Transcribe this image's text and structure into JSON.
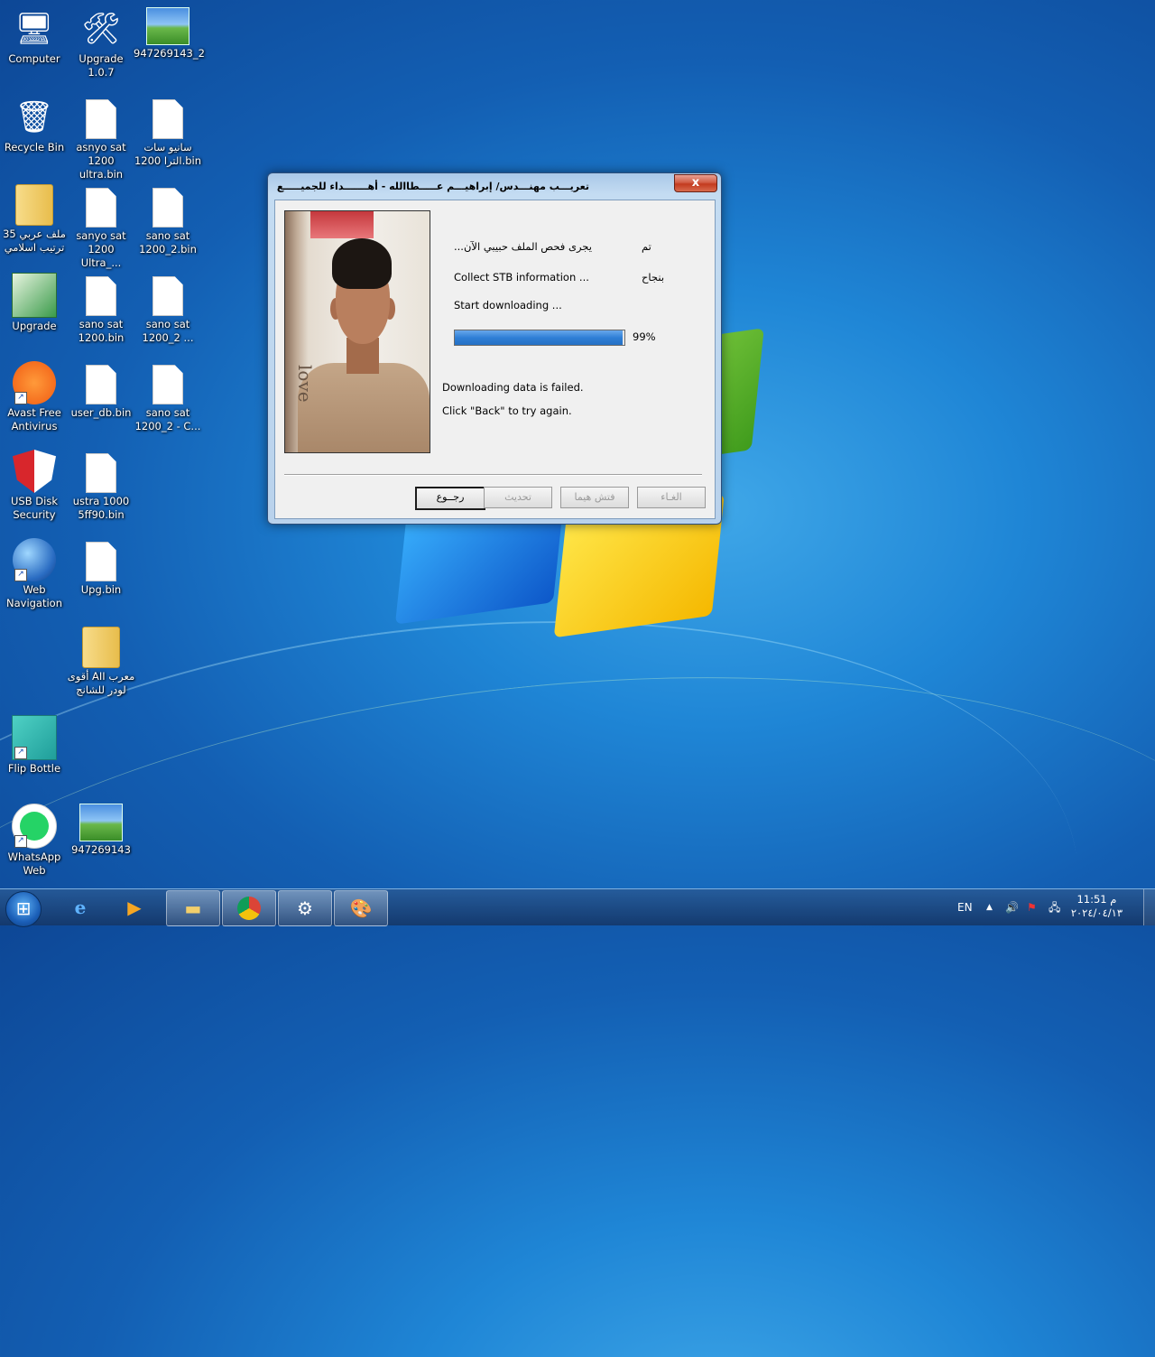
{
  "desktop": {
    "icons": [
      {
        "label": "Computer",
        "icon": "computer-icon"
      },
      {
        "label": "Upgrade 1.0.7",
        "icon": "tools-icon"
      },
      {
        "label": "947269143_2",
        "icon": "image-file-icon"
      },
      {
        "label": "Recycle Bin",
        "icon": "recycle-bin-icon"
      },
      {
        "label": "asnyo sat 1200 ultra.bin",
        "icon": "file-icon"
      },
      {
        "label": "سانيو سات الترا 1200.bin",
        "icon": "file-icon"
      },
      {
        "label": "35 ملف عربي ترتيب اسلامي",
        "icon": "folder-icon"
      },
      {
        "label": "sanyo sat 1200 Ultra_...",
        "icon": "file-icon"
      },
      {
        "label": "sano sat 1200_2.bin",
        "icon": "file-icon"
      },
      {
        "label": "Upgrade",
        "icon": "ali-upgrade-icon"
      },
      {
        "label": "sano sat 1200.bin",
        "icon": "file-icon"
      },
      {
        "label": "sano sat 1200_2 ...",
        "icon": "file-icon"
      },
      {
        "label": "Avast Free Antivirus",
        "icon": "avast-icon"
      },
      {
        "label": "user_db.bin",
        "icon": "file-icon"
      },
      {
        "label": "sano sat 1200_2 - C...",
        "icon": "file-icon"
      },
      {
        "label": "USB Disk Security",
        "icon": "shield-icon"
      },
      {
        "label": "ustra 1000 5ff90.bin",
        "icon": "file-icon"
      },
      {
        "label": "Web Navigation",
        "icon": "globe-icon"
      },
      {
        "label": "Upg.bin",
        "icon": "file-icon"
      },
      {
        "label": "أقوى AII معرب لودر للشانج",
        "icon": "folder-icon"
      },
      {
        "label": "Flip Bottle",
        "icon": "flip-bottle-icon"
      },
      {
        "label": "WhatsApp Web",
        "icon": "whatsapp-icon"
      },
      {
        "label": "947269143",
        "icon": "image-file-icon"
      }
    ]
  },
  "dialog": {
    "title": "تعريـــب مهنـــدس/ إبراهيـــم عـــــطاالله - أهـــــــداء للجميـــــع",
    "close_label": "x",
    "status_right": [
      "تم",
      "بنجاح"
    ],
    "status_lines": [
      "يجرى فحص الملف حبيبي الآن...",
      "Collect STB information ...",
      "Start downloading ..."
    ],
    "progress_percent": 99,
    "progress_label": "99%",
    "message_lines": [
      "Downloading data is failed.",
      "Click \"Back\" to try again."
    ],
    "photo_caption": "love",
    "buttons": {
      "back": "رجــوع",
      "update": "تحديث",
      "forward": "فتش هيما",
      "cancel": "الغـاء"
    }
  },
  "taskbar": {
    "start_icon": "windows-start-icon",
    "pinned": [
      {
        "icon": "internet-explorer-icon"
      },
      {
        "icon": "media-player-icon"
      },
      {
        "icon": "file-explorer-icon"
      },
      {
        "icon": "chrome-icon"
      },
      {
        "icon": "upgrade-tool-icon"
      },
      {
        "icon": "paint-icon"
      }
    ],
    "language": "EN",
    "clock_time": "11:51 م",
    "clock_date": "٢٠٢٤/٠٤/١٣"
  }
}
